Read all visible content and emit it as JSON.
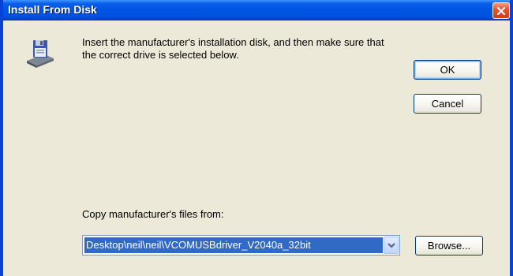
{
  "window": {
    "title": "Install From Disk",
    "close_icon": "close-icon"
  },
  "message": "Insert the manufacturer's installation disk, and then make sure that the correct drive is selected below.",
  "icon": "install-disk-icon",
  "buttons": {
    "ok": "OK",
    "cancel": "Cancel",
    "browse": "Browse..."
  },
  "copy_from": {
    "label": "Copy manufacturer's files from:",
    "value": "Desktop\\neil\\neil\\VCOMUSBdriver_V2040a_32bit",
    "dropdown_icon": "chevron-down-icon"
  },
  "colors": {
    "titlebar": "#0055e5",
    "close": "#d23c14",
    "selection": "#316ac5",
    "face": "#ece9d8"
  }
}
